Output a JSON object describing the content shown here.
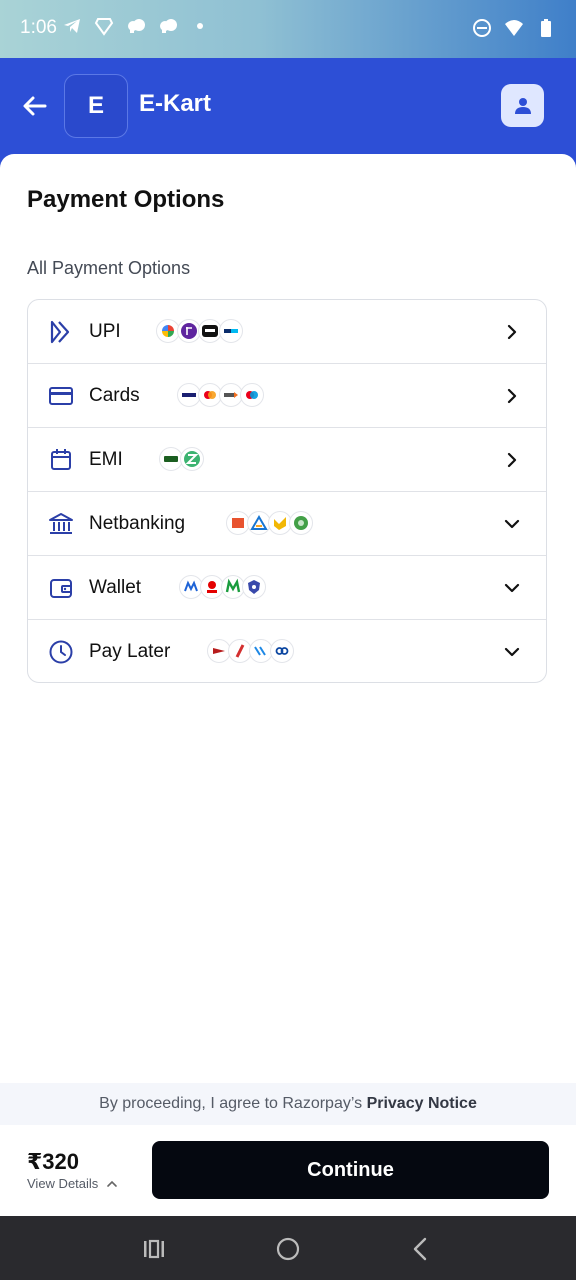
{
  "status_bar": {
    "time": "1:06"
  },
  "header": {
    "logo_letter": "E",
    "merchant_name": "E-Kart"
  },
  "main": {
    "title": "Payment Options",
    "section_label": "All Payment Options",
    "options": [
      {
        "label": "UPI",
        "icon": "upi-icon",
        "expand": "chevron-right"
      },
      {
        "label": "Cards",
        "icon": "card-icon",
        "expand": "chevron-right"
      },
      {
        "label": "EMI",
        "icon": "calendar-icon",
        "expand": "chevron-right"
      },
      {
        "label": "Netbanking",
        "icon": "bank-icon",
        "expand": "chevron-down"
      },
      {
        "label": "Wallet",
        "icon": "wallet-icon",
        "expand": "chevron-down"
      },
      {
        "label": "Pay Later",
        "icon": "clock-icon",
        "expand": "chevron-down"
      }
    ]
  },
  "footer": {
    "consent_prefix": "By proceeding, I agree to Razorpay’s",
    "consent_link": "Privacy Notice",
    "amount": "₹320",
    "view_details": "View Details",
    "continue_label": "Continue"
  },
  "colors": {
    "header_bg": "#2d4fd6",
    "icon_blue": "#2b3fa8",
    "button_bg": "#050810"
  }
}
